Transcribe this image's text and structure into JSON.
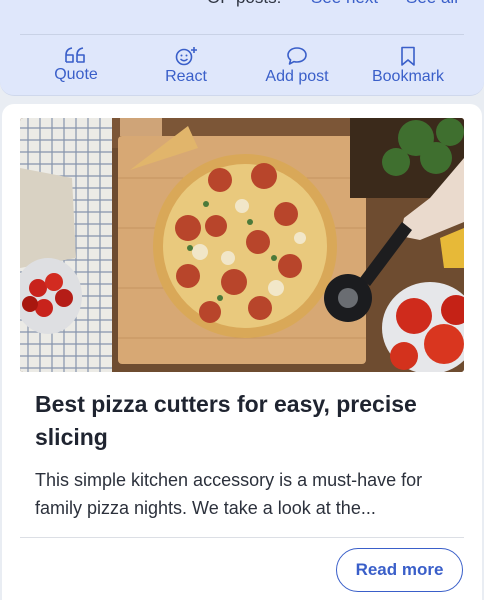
{
  "post_nav": {
    "op_posts_label": "OP posts:",
    "see_next": "See next",
    "see_all": "See all"
  },
  "actions": {
    "quote": "Quote",
    "react": "React",
    "add_post": "Add post",
    "bookmark": "Bookmark"
  },
  "article": {
    "title": "Best pizza cutters for easy, precise slicing",
    "description": "This simple kitchen accessory is a must-have for family pizza nights. We take a look at the...",
    "read_more": "Read more"
  },
  "colors": {
    "accent": "#3a5fc9",
    "panel_bg": "#dfe7fb",
    "title_text": "#1f2430"
  }
}
